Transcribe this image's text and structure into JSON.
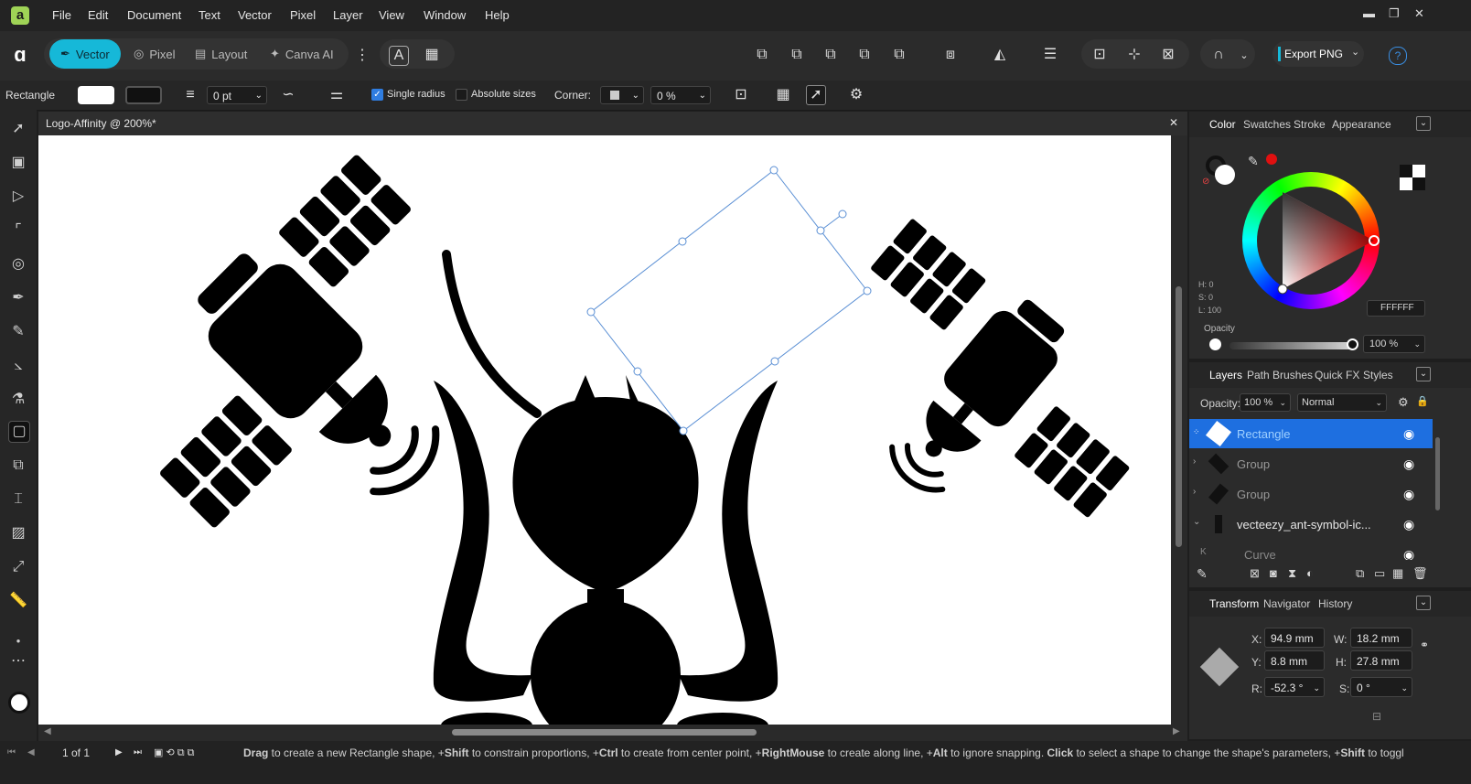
{
  "app": {
    "logo_letter": "a"
  },
  "menu": [
    "File",
    "Edit",
    "Document",
    "Text",
    "Vector",
    "Pixel",
    "Layer",
    "View",
    "Window",
    "Help"
  ],
  "window_controls": {
    "minimize": "▬",
    "restore": "❐",
    "close": "✕"
  },
  "personas": {
    "vector": "Vector",
    "pixel": "Pixel",
    "layout": "Layout",
    "canva_ai": "Canva AI"
  },
  "toolbar": {
    "export_label": "Export PNG",
    "help": "?"
  },
  "context": {
    "tool_name": "Rectangle",
    "stroke_width": "0 pt",
    "single_radius_label": "Single radius",
    "absolute_sizes_label": "Absolute sizes",
    "corner_label": "Corner:",
    "corner_value": "0 %"
  },
  "document": {
    "tab_title": "Logo-Affinity @ 200%*",
    "close": "✕"
  },
  "color_panel": {
    "tabs": [
      "Color",
      "Swatches",
      "Stroke",
      "Appearance"
    ],
    "h": "H: 0",
    "s": "S: 0",
    "l": "L: 100",
    "hex": "FFFFFF",
    "opacity_label": "Opacity",
    "opacity_value": "100 %"
  },
  "layers_panel": {
    "tabs": [
      "Layers",
      "Path Brushes",
      "Quick FX",
      "Styles"
    ],
    "opacity_label": "Opacity:",
    "opacity_value": "100 %",
    "blend_mode": "Normal",
    "layers": [
      "Rectangle",
      "Group",
      "Group",
      "vecteezy_ant-symbol-ic...",
      "Curve"
    ]
  },
  "transform_panel": {
    "tabs": [
      "Transform",
      "Navigator",
      "History"
    ],
    "x_label": "X:",
    "x": "94.9 mm",
    "y_label": "Y:",
    "y": "8.8 mm",
    "w_label": "W:",
    "w": "18.2 mm",
    "h_label": "H:",
    "h": "27.8 mm",
    "r_label": "R:",
    "r": "-52.3 °",
    "s_label": "S:",
    "s": "0 °"
  },
  "status": {
    "page": "1 of 1",
    "hint_drag": "Drag",
    "hint1": " to create a new Rectangle shape, +",
    "hint_shift": "Shift",
    "hint2": " to constrain proportions, +",
    "hint_ctrl": "Ctrl",
    "hint3": " to create from center point, +",
    "hint_rmouse": "RightMouse",
    "hint4": " to create along line, +",
    "hint_alt": "Alt",
    "hint5": " to ignore snapping. ",
    "hint_click": "Click",
    "hint6": " to select a shape to change the shape's parameters, +",
    "hint_shift2": "Shift",
    "hint7": " to toggl"
  },
  "colors": {
    "accent": "#16b8d8",
    "selected_layer": "#1e6fe0",
    "canvas": "#ffffff"
  }
}
